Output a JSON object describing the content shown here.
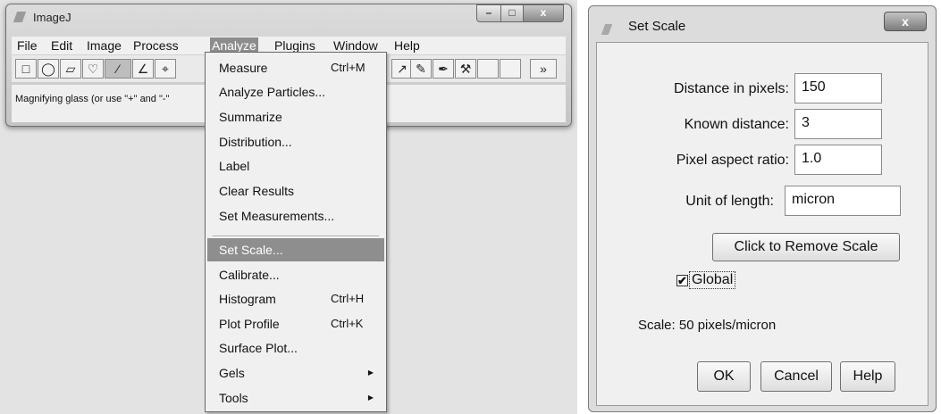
{
  "imagej": {
    "title": "ImageJ",
    "caption_buttons": {
      "minimize": "–",
      "maximize": "□",
      "close": "x"
    },
    "menubar": [
      "File",
      "Edit",
      "Image",
      "Process",
      "Analyze",
      "Plugins",
      "Window",
      "Help"
    ],
    "active_menu": "Analyze",
    "toolbar_left": [
      {
        "name": "rectangle-tool-icon",
        "glyph": "□"
      },
      {
        "name": "oval-tool-icon",
        "glyph": "◯"
      },
      {
        "name": "polygon-tool-icon",
        "glyph": "▱"
      },
      {
        "name": "freehand-tool-icon",
        "glyph": "♡"
      },
      {
        "name": "line-tool-icon",
        "glyph": "⁄"
      },
      {
        "name": "angle-tool-icon",
        "glyph": "∠"
      },
      {
        "name": "point-tool-icon",
        "glyph": "⌖"
      }
    ],
    "toolbar_right": [
      {
        "name": "color-picker-icon",
        "glyph": "↗"
      },
      {
        "name": "pencil-tool-icon",
        "glyph": "✎"
      },
      {
        "name": "brush-tool-icon",
        "glyph": "✒"
      },
      {
        "name": "flood-fill-icon",
        "glyph": "⚒"
      },
      {
        "name": "empty-slot-1",
        "glyph": ""
      },
      {
        "name": "empty-slot-2",
        "glyph": ""
      },
      {
        "name": "more-tools-icon",
        "glyph": "»"
      }
    ],
    "status": "Magnifying glass (or use \"+\" and \"-\""
  },
  "analyze_menu": {
    "items": [
      {
        "label": "Measure",
        "shortcut": "Ctrl+M"
      },
      {
        "label": "Analyze Particles...",
        "shortcut": ""
      },
      {
        "label": "Summarize",
        "shortcut": ""
      },
      {
        "label": "Distribution...",
        "shortcut": ""
      },
      {
        "label": "Label",
        "shortcut": ""
      },
      {
        "label": "Clear Results",
        "shortcut": ""
      },
      {
        "label": "Set Measurements...",
        "shortcut": ""
      },
      {
        "label": "Set Scale...",
        "shortcut": "",
        "highlighted": true
      },
      {
        "label": "Calibrate...",
        "shortcut": ""
      },
      {
        "label": "Histogram",
        "shortcut": "Ctrl+H"
      },
      {
        "label": "Plot Profile",
        "shortcut": "Ctrl+K"
      },
      {
        "label": "Surface Plot...",
        "shortcut": ""
      },
      {
        "label": "Gels",
        "shortcut": "",
        "submenu": true
      },
      {
        "label": "Tools",
        "shortcut": "",
        "submenu": true
      }
    ],
    "submenu_arrow": "▶"
  },
  "set_scale": {
    "title": "Set Scale",
    "close_glyph": "x",
    "distance_label": "Distance in pixels:",
    "distance_value": "150",
    "known_label": "Known distance:",
    "known_value": "3",
    "aspect_label": "Pixel aspect ratio:",
    "aspect_value": "1.0",
    "unit_label": "Unit of length:",
    "unit_value": "micron",
    "remove_button": "Click to Remove Scale",
    "global_label": "Global",
    "global_checked": true,
    "check_glyph": "✔",
    "scale_text": "Scale: 50 pixels/micron",
    "ok": "OK",
    "cancel": "Cancel",
    "help": "Help"
  }
}
